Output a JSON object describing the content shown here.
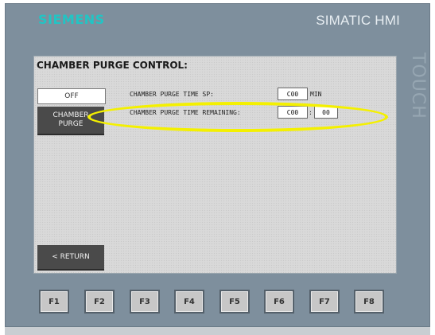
{
  "device": {
    "brand": "SIEMENS",
    "model": "SIMATIC HMI",
    "side_label": "TOUCH"
  },
  "screen": {
    "title": "CHAMBER PURGE CONTROL:",
    "off_button": "OFF",
    "purge_button": [
      "CHAMBER",
      "PURGE"
    ],
    "return_button": "< RETURN",
    "purge_time_sp": {
      "label": "CHAMBER PURGE TIME SP:",
      "value": "C00",
      "unit": "MIN"
    },
    "purge_time_remaining": {
      "label": "CHAMBER PURGE TIME REMAINING:",
      "minutes": "C00",
      "separator": ":",
      "seconds": "00"
    }
  },
  "function_keys": [
    "F1",
    "F2",
    "F3",
    "F4",
    "F5",
    "F6",
    "F7",
    "F8"
  ],
  "colors": {
    "bezel": "#7e8f9d",
    "brand": "#22c4c4",
    "highlight": "#f4f000",
    "screen_bg": "#d9d9d9",
    "dark_button": "#4a4a4a"
  }
}
